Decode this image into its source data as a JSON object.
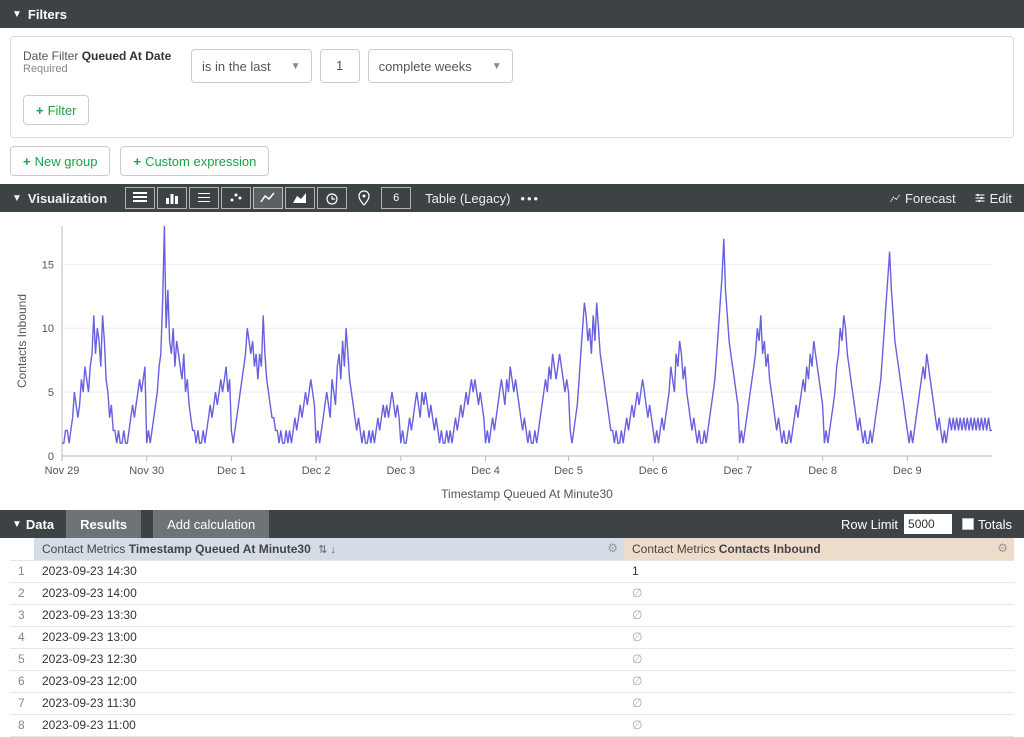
{
  "filters": {
    "header": "Filters",
    "label_prefix": "Date Filter",
    "label_bold": "Queued At Date",
    "required": "Required",
    "condition": "is in the last",
    "value": "1",
    "unit": "complete weeks",
    "add_filter_btn": "Filter"
  },
  "groups": {
    "new_group": "New group",
    "custom_expr": "Custom expression"
  },
  "viz": {
    "header": "Visualization",
    "table_legacy": "Table (Legacy)",
    "forecast": "Forecast",
    "edit": "Edit"
  },
  "data": {
    "header": "Data",
    "results_tab": "Results",
    "add_calc": "Add calculation",
    "row_limit_label": "Row Limit",
    "row_limit_value": "5000",
    "totals_label": "Totals",
    "col1_prefix": "Contact Metrics",
    "col1_bold": "Timestamp Queued At Minute30",
    "col2_prefix": "Contact Metrics",
    "col2_bold": "Contacts Inbound",
    "rows": [
      {
        "idx": "1",
        "ts": "2023-09-23 14:30",
        "val": "1"
      },
      {
        "idx": "2",
        "ts": "2023-09-23 14:00",
        "val": "∅"
      },
      {
        "idx": "3",
        "ts": "2023-09-23 13:30",
        "val": "∅"
      },
      {
        "idx": "4",
        "ts": "2023-09-23 13:00",
        "val": "∅"
      },
      {
        "idx": "5",
        "ts": "2023-09-23 12:30",
        "val": "∅"
      },
      {
        "idx": "6",
        "ts": "2023-09-23 12:00",
        "val": "∅"
      },
      {
        "idx": "7",
        "ts": "2023-09-23 11:30",
        "val": "∅"
      },
      {
        "idx": "8",
        "ts": "2023-09-23 11:00",
        "val": "∅"
      }
    ]
  },
  "chart_data": {
    "type": "line",
    "title": "",
    "ylabel": "Contacts Inbound",
    "xlabel": "Timestamp Queued At Minute30",
    "ylim": [
      0,
      18
    ],
    "yticks": [
      0,
      5,
      10,
      15
    ],
    "categories": [
      "Nov 29",
      "Nov 30",
      "Dec 1",
      "Dec 2",
      "Dec 3",
      "Dec 4",
      "Dec 5",
      "Dec 6",
      "Dec 7",
      "Dec 8",
      "Dec 9"
    ],
    "series": [
      {
        "name": "Contacts Inbound",
        "color": "#6860e0",
        "values": [
          1,
          1,
          2,
          2,
          1,
          2,
          3,
          5,
          4,
          3,
          4,
          6,
          5,
          7,
          6,
          5,
          7,
          8,
          11,
          8,
          10,
          9,
          7,
          11,
          9,
          6,
          5,
          3,
          4,
          2,
          2,
          1,
          2,
          1,
          1,
          2,
          1,
          1,
          2,
          3,
          4,
          3,
          4,
          5,
          6,
          5,
          6,
          7,
          1,
          2,
          1,
          2,
          3,
          4,
          5,
          7,
          8,
          12,
          18,
          10,
          13,
          9,
          8,
          10,
          7,
          9,
          8,
          7,
          6,
          8,
          5,
          6,
          4,
          3,
          2,
          2,
          1,
          2,
          1,
          1,
          2,
          1,
          2,
          3,
          4,
          3,
          4,
          5,
          4,
          5,
          6,
          5,
          6,
          7,
          5,
          6,
          2,
          1,
          2,
          3,
          4,
          5,
          6,
          7,
          8,
          10,
          9,
          8,
          9,
          7,
          8,
          6,
          8,
          7,
          11,
          8,
          6,
          5,
          4,
          3,
          3,
          2,
          2,
          1,
          2,
          1,
          1,
          2,
          1,
          2,
          1,
          2,
          3,
          2,
          3,
          4,
          3,
          4,
          5,
          4,
          5,
          6,
          5,
          4,
          1,
          2,
          1,
          2,
          3,
          4,
          5,
          4,
          3,
          6,
          5,
          4,
          7,
          8,
          6,
          9,
          7,
          10,
          8,
          6,
          5,
          4,
          3,
          2,
          3,
          2,
          1,
          2,
          1,
          1,
          2,
          1,
          2,
          1,
          2,
          3,
          2,
          3,
          4,
          3,
          4,
          3,
          4,
          5,
          4,
          3,
          4,
          3,
          1,
          2,
          1,
          1,
          2,
          3,
          2,
          3,
          4,
          5,
          4,
          3,
          5,
          4,
          5,
          4,
          3,
          4,
          3,
          2,
          3,
          2,
          1,
          2,
          1,
          1,
          2,
          1,
          2,
          1,
          2,
          3,
          2,
          3,
          4,
          3,
          4,
          5,
          4,
          5,
          6,
          5,
          6,
          5,
          4,
          5,
          4,
          3,
          1,
          2,
          1,
          2,
          3,
          2,
          3,
          4,
          5,
          6,
          5,
          4,
          6,
          5,
          7,
          6,
          5,
          6,
          5,
          4,
          3,
          2,
          3,
          2,
          1,
          2,
          1,
          1,
          2,
          1,
          2,
          3,
          4,
          5,
          6,
          5,
          7,
          6,
          8,
          7,
          6,
          7,
          8,
          7,
          6,
          5,
          6,
          5,
          2,
          1,
          2,
          3,
          4,
          6,
          8,
          10,
          12,
          11,
          9,
          10,
          8,
          11,
          9,
          12,
          10,
          8,
          7,
          6,
          5,
          4,
          3,
          2,
          2,
          1,
          2,
          1,
          1,
          2,
          1,
          2,
          3,
          2,
          3,
          4,
          3,
          4,
          5,
          4,
          5,
          6,
          5,
          4,
          3,
          4,
          3,
          2,
          1,
          2,
          1,
          2,
          3,
          2,
          3,
          4,
          5,
          7,
          6,
          5,
          8,
          7,
          9,
          8,
          6,
          7,
          5,
          4,
          3,
          2,
          3,
          2,
          1,
          2,
          1,
          1,
          2,
          1,
          2,
          3,
          4,
          5,
          6,
          8,
          10,
          12,
          14,
          17,
          13,
          11,
          9,
          8,
          7,
          6,
          5,
          4,
          1,
          2,
          1,
          2,
          3,
          4,
          5,
          6,
          7,
          8,
          10,
          9,
          11,
          8,
          9,
          7,
          8,
          6,
          5,
          4,
          3,
          2,
          3,
          2,
          1,
          2,
          1,
          1,
          2,
          1,
          2,
          3,
          4,
          3,
          4,
          5,
          6,
          5,
          7,
          6,
          8,
          7,
          9,
          8,
          7,
          6,
          5,
          4,
          1,
          2,
          1,
          2,
          3,
          4,
          5,
          7,
          8,
          10,
          9,
          11,
          10,
          8,
          7,
          6,
          5,
          4,
          3,
          2,
          3,
          2,
          1,
          2,
          1,
          1,
          2,
          1,
          2,
          3,
          4,
          5,
          6,
          8,
          10,
          12,
          14,
          16,
          13,
          11,
          9,
          8,
          7,
          6,
          5,
          4,
          3,
          2,
          1,
          2,
          1,
          2,
          3,
          4,
          5,
          6,
          7,
          6,
          8,
          7,
          6,
          5,
          4,
          3,
          2,
          3,
          2,
          1,
          2,
          1,
          2,
          3,
          2,
          3,
          2,
          3,
          2,
          3,
          2,
          3,
          2,
          3,
          2,
          3,
          2,
          3,
          2,
          3,
          2,
          3,
          2,
          3,
          2,
          3,
          2,
          2
        ]
      }
    ]
  }
}
